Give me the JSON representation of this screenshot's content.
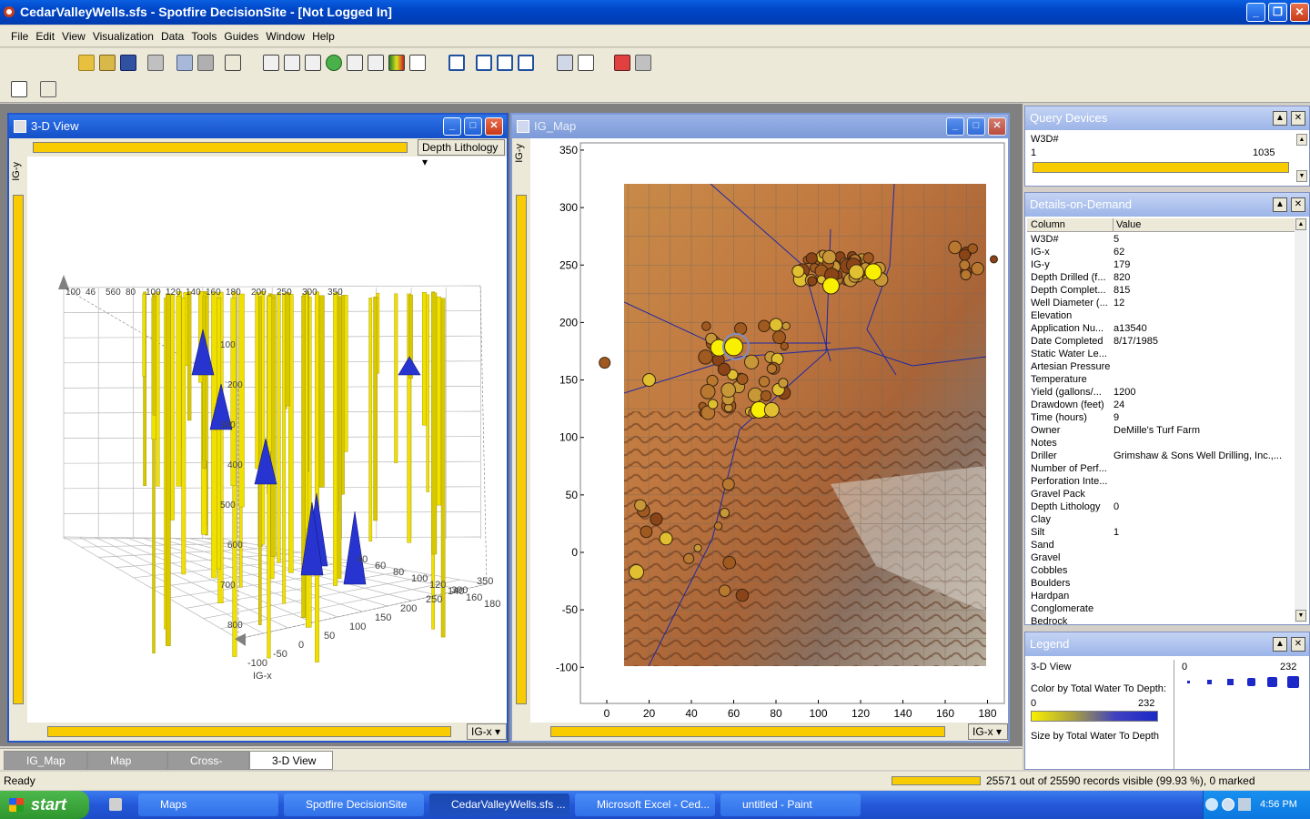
{
  "window": {
    "title": "CedarValleyWells.sfs - Spotfire DecisionSite - [Not Logged In]"
  },
  "menu": [
    "File",
    "Edit",
    "View",
    "Visualization",
    "Data",
    "Tools",
    "Guides",
    "Window",
    "Help"
  ],
  "view3d": {
    "title": "3-D View",
    "axis_y": "IG-y",
    "axis_x": "IG-x",
    "combo_color": "Depth Lithology",
    "x_ticks": [
      "-100",
      "-50",
      "0",
      "50",
      "100",
      "150",
      "200",
      "250",
      "300",
      "350"
    ],
    "z_ticks": [
      "40",
      "60",
      "80",
      "100",
      "120",
      "140",
      "160",
      "180"
    ],
    "depth_ticks": [
      "100",
      "200",
      "300",
      "400",
      "500",
      "600",
      "700",
      "800"
    ],
    "top_ticks": [
      "100",
      "46",
      "560",
      "80",
      "100",
      "120",
      "140",
      "160",
      "180",
      "200",
      "250",
      "300",
      "350"
    ]
  },
  "igmap": {
    "title": "IG_Map",
    "axis_y": "IG-y",
    "axis_x": "IG-x",
    "y_ticks": [
      "350",
      "300",
      "250",
      "200",
      "150",
      "100",
      "50",
      "0",
      "-50",
      "-100"
    ],
    "x_ticks": [
      "0",
      "20",
      "40",
      "60",
      "80",
      "100",
      "120",
      "140",
      "160",
      "180"
    ]
  },
  "query_devices": {
    "title": "Query Devices",
    "field": "W3D#",
    "min": "1",
    "max": "1035"
  },
  "dod": {
    "title": "Details-on-Demand",
    "col_header": "Column",
    "val_header": "Value",
    "rows": [
      {
        "c": "W3D#",
        "v": "5"
      },
      {
        "c": "IG-x",
        "v": "62"
      },
      {
        "c": "IG-y",
        "v": "179"
      },
      {
        "c": "Depth Drilled (f...",
        "v": "820"
      },
      {
        "c": "Depth Complet...",
        "v": "815"
      },
      {
        "c": "Well Diameter (...",
        "v": "12"
      },
      {
        "c": "Elevation",
        "v": ""
      },
      {
        "c": "Application Nu...",
        "v": "a13540"
      },
      {
        "c": "Date Completed",
        "v": "8/17/1985"
      },
      {
        "c": "Static Water Le...",
        "v": ""
      },
      {
        "c": "Artesian Pressure",
        "v": ""
      },
      {
        "c": "Temperature",
        "v": ""
      },
      {
        "c": "Yield (gallons/...",
        "v": "1200"
      },
      {
        "c": "Drawdown (feet)",
        "v": "24"
      },
      {
        "c": "Time (hours)",
        "v": "9"
      },
      {
        "c": "Owner",
        "v": "DeMille's Turf Farm"
      },
      {
        "c": "Notes",
        "v": ""
      },
      {
        "c": "Driller",
        "v": "Grimshaw & Sons Well Drilling, Inc.,..."
      },
      {
        "c": "Number of Perf...",
        "v": ""
      },
      {
        "c": "Perforation Inte...",
        "v": ""
      },
      {
        "c": "Gravel Pack",
        "v": ""
      },
      {
        "c": "Depth Lithology",
        "v": "0"
      },
      {
        "c": "Clay",
        "v": ""
      },
      {
        "c": "Silt",
        "v": "1"
      },
      {
        "c": "Sand",
        "v": ""
      },
      {
        "c": "Gravel",
        "v": ""
      },
      {
        "c": "Cobbles",
        "v": ""
      },
      {
        "c": "Boulders",
        "v": ""
      },
      {
        "c": "Hardpan",
        "v": ""
      },
      {
        "c": "Conglomerate",
        "v": ""
      },
      {
        "c": "Bedrock",
        "v": ""
      }
    ]
  },
  "legend": {
    "title": "Legend",
    "view": "3-D View",
    "color_by": "Color by Total Water To Depth:",
    "color_min": "0",
    "color_max": "232",
    "size_by": "Size by Total Water To Depth",
    "size_min": "0",
    "size_max": "232"
  },
  "tabs": [
    "IG_Map",
    "Map",
    "Cross-Section",
    "3-D View"
  ],
  "status": {
    "left": "Ready",
    "right": "25571 out of 25590 records visible (99.93 %), 0 marked"
  },
  "taskbar": {
    "start": "start",
    "items": [
      "Maps",
      "Spotfire DecisionSite",
      "CedarValleyWells.sfs ...",
      "Microsoft Excel - Ced...",
      "untitled - Paint"
    ],
    "clock": "4:56 PM"
  },
  "colors": {
    "yellow": "#f8e800",
    "blue": "#1c28c8",
    "title_blue": "#0a5fe0"
  }
}
